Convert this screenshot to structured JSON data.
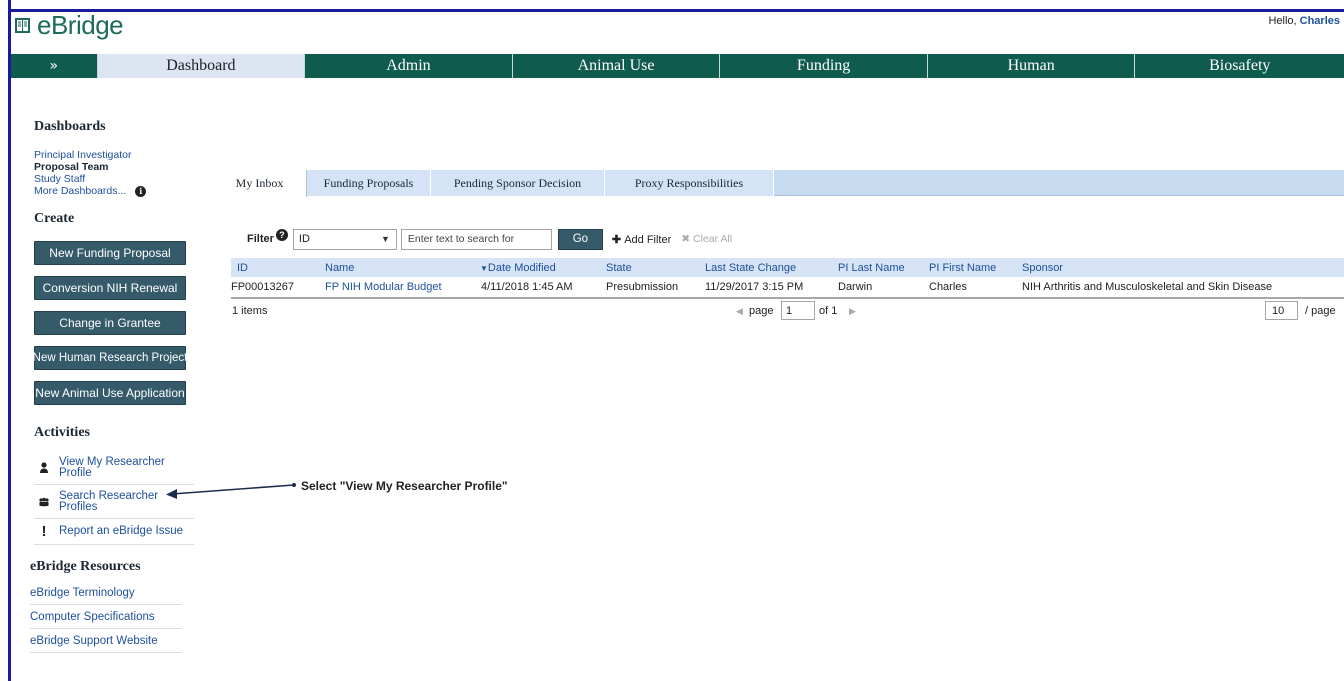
{
  "header": {
    "app_name": "eBridge",
    "greeting": "Hello, ",
    "user_name": "Charles"
  },
  "nav": {
    "expand_glyph": "»",
    "tabs": [
      "Dashboard",
      "Admin",
      "Animal Use",
      "Funding",
      "Human",
      "Biosafety"
    ],
    "active_tab": "Dashboard"
  },
  "sidebar": {
    "dashboards_title": "Dashboards",
    "dashboards": [
      "Principal Investigator",
      "Proposal Team",
      "Study Staff",
      "More Dashboards..."
    ],
    "active_dashboard": "Proposal Team",
    "create_title": "Create",
    "create_buttons": [
      "New Funding Proposal",
      "Conversion NIH Renewal",
      "Change in Grantee",
      "New Human Research Project",
      "New Animal Use Application"
    ],
    "activities_title": "Activities",
    "activities": [
      {
        "label": "View My Researcher Profile",
        "icon": "person-icon"
      },
      {
        "label": "Search Researcher Profiles",
        "icon": "people-icon"
      },
      {
        "label": "Report an eBridge Issue",
        "icon": "exclamation-icon"
      }
    ],
    "resources_title": "eBridge Resources",
    "resources": [
      "eBridge Terminology",
      "Computer Specifications",
      "eBridge Support Website"
    ]
  },
  "inbox_tabs": [
    "My Inbox",
    "Funding Proposals",
    "Pending Sponsor Decision",
    "Proxy Responsibilities"
  ],
  "active_inbox_tab": "My Inbox",
  "filter": {
    "label": "Filter",
    "field_value": "ID",
    "search_placeholder": "Enter text to search for",
    "go_label": "Go",
    "add_filter_label": "Add Filter",
    "clear_all_label": "Clear All"
  },
  "table": {
    "columns": [
      "ID",
      "Name",
      "Date Modified",
      "State",
      "Last State Change",
      "PI Last Name",
      "PI First Name",
      "Sponsor"
    ],
    "sorted_column": "Date Modified",
    "rows": [
      [
        "FP00013267",
        "FP NIH Modular Budget",
        "4/11/2018 1:45 AM",
        "Presubmission",
        "11/29/2017 3:15 PM",
        "Darwin",
        "Charles",
        "NIH Arthritis and Musculoskeletal and Skin Disease"
      ]
    ],
    "item_count": "1 items",
    "page_label": "page",
    "page_value": "1",
    "page_of": "of 1",
    "per_page_value": "10",
    "per_page_label": "/ page"
  },
  "annotation": {
    "text": "Select \"View My Researcher Profile\""
  },
  "colors": {
    "nav_bg": "#0f5b4d",
    "brand": "#1d6b5a",
    "button_bg": "#355a6a",
    "link": "#1d4f9c",
    "tab_strip": "#c6daf0"
  }
}
